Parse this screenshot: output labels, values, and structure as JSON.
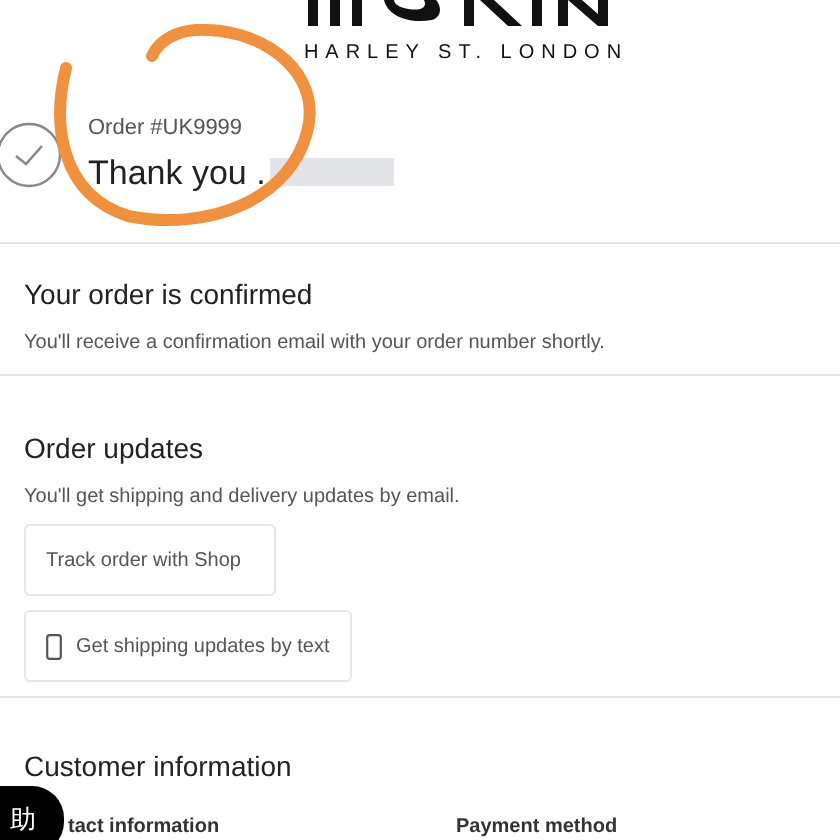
{
  "brand": {
    "tagline": "HARLEY ST. LONDON"
  },
  "header": {
    "order_number": "Order #UK9999",
    "greeting": "Thank you ."
  },
  "confirmation": {
    "title": "Your order is confirmed",
    "text": "You'll receive a confirmation email with your order number shortly."
  },
  "updates": {
    "title": "Order updates",
    "text": "You'll get shipping and delivery updates by email.",
    "buttons": [
      {
        "label": "Track order with Shop",
        "kind": "plain"
      },
      {
        "label": "Get shipping updates by text",
        "kind": "phone"
      }
    ]
  },
  "customer": {
    "title": "Customer information",
    "columns": [
      "tact information",
      "Payment method"
    ]
  },
  "help_badge": {
    "label": "助"
  }
}
